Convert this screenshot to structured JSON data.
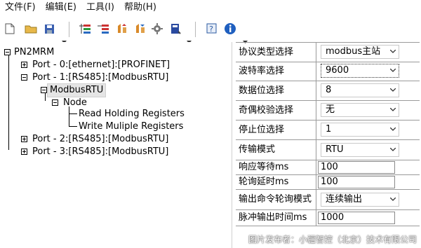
{
  "menu": [
    "文件(F)",
    "编辑(E)",
    "工具(I)",
    "帮助(H)"
  ],
  "tree": {
    "root": "PN2MRM",
    "port0": "Port - 0:[ethernet]:[PROFINET]",
    "port1": "Port - 1:[RS485]:[ModbusRTU]",
    "modbus": "ModbusRTU",
    "node": "Node",
    "read": "Read Holding Registers",
    "write": "Write Muliple Registers",
    "port2": "Port - 2:[RS485]:[ModbusRTU]",
    "port3": "Port - 3:[RS485]:[ModbusRTU]"
  },
  "props": [
    {
      "name": "协议类型选择",
      "value": "modbus主站",
      "kind": "select"
    },
    {
      "name": "波特率选择",
      "value": "9600",
      "kind": "select"
    },
    {
      "name": "数据位选择",
      "value": "8",
      "kind": "select"
    },
    {
      "name": "奇偶校验选择",
      "value": "无",
      "kind": "select"
    },
    {
      "name": "停止位选择",
      "value": "1",
      "kind": "select"
    },
    {
      "name": "传输模式",
      "value": "RTU",
      "kind": "select"
    },
    {
      "name": "响应等待ms",
      "value": "100",
      "kind": "input"
    },
    {
      "name": "轮询延时ms",
      "value": "100",
      "kind": "input"
    },
    {
      "name": "输出命令轮询模式",
      "value": "连续输出",
      "kind": "select"
    },
    {
      "name": "脉冲输出时间ms",
      "value": "1000",
      "kind": "input"
    }
  ],
  "credit": "图片发布者：小疆智控（北京）技术有限公司"
}
